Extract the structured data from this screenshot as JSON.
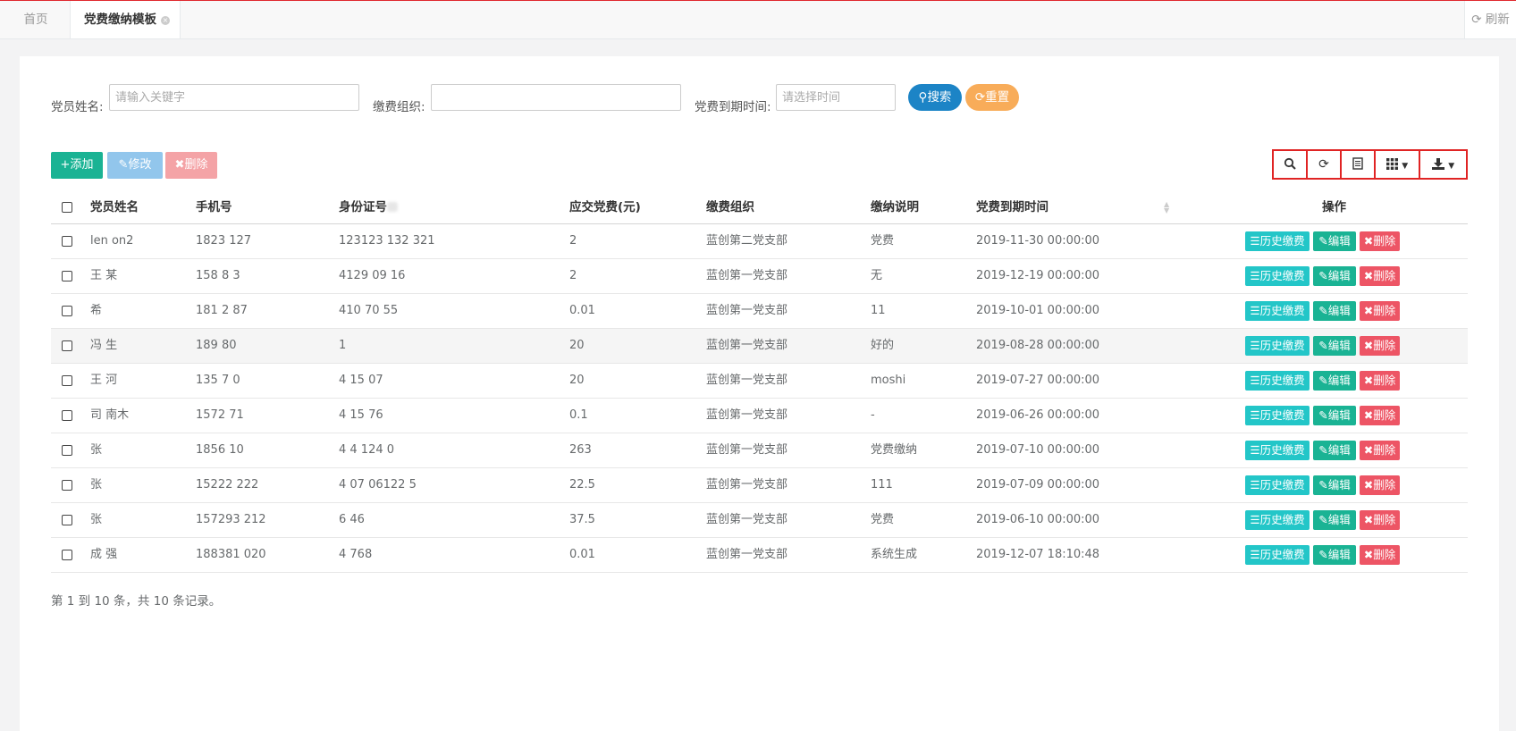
{
  "tabs": {
    "home": "首页",
    "active": "党费缴纳模板",
    "refresh": "刷新"
  },
  "search": {
    "name_label": "党员姓名:",
    "name_placeholder": "请输入关键字",
    "org_label": "缴费组织:",
    "org_value": "",
    "expire_label": "党费到期时间:",
    "expire_placeholder": "请选择时间",
    "search_btn": "搜索",
    "reset_btn": "重置"
  },
  "actions": {
    "add": "添加",
    "edit": "修改",
    "delete": "删除"
  },
  "colors": {
    "accent_red": "#e02424",
    "primary": "#1ab394",
    "info": "#23c6c8",
    "danger": "#ed5565",
    "search_blue": "#1c84c6",
    "reset_orange": "#f8ac59"
  },
  "table": {
    "headers": [
      "党员姓名",
      "手机号",
      "身份证号",
      "应交党费(元)",
      "缴费组织",
      "缴纳说明",
      "党费到期时间",
      "操作"
    ],
    "op_labels": {
      "history": "历史缴费",
      "edit": "编辑",
      "delete": "删除"
    },
    "rows": [
      {
        "name": "len on2",
        "phone": "1823 127",
        "id": "123123 132 321",
        "fee": "2",
        "org": "蓝创第二党支部",
        "note": "党费",
        "expire": "2019-11-30 00:00:00"
      },
      {
        "name": "王 某",
        "phone": "158 8 3",
        "id": "4129 09 16",
        "fee": "2",
        "org": "蓝创第一党支部",
        "note": "无",
        "expire": "2019-12-19 00:00:00"
      },
      {
        "name": "希",
        "phone": "181 2 87",
        "id": "410 70 55",
        "fee": "0.01",
        "org": "蓝创第一党支部",
        "note": "11",
        "expire": "2019-10-01 00:00:00"
      },
      {
        "name": "冯 生",
        "phone": "189 80",
        "id": "1",
        "fee": "20",
        "org": "蓝创第一党支部",
        "note": "好的",
        "expire": "2019-08-28 00:00:00"
      },
      {
        "name": "王 河",
        "phone": "135 7 0",
        "id": "4 15 07",
        "fee": "20",
        "org": "蓝创第一党支部",
        "note": "moshi",
        "expire": "2019-07-27 00:00:00"
      },
      {
        "name": "司 南木",
        "phone": "1572 71",
        "id": "4 15 76",
        "fee": "0.1",
        "org": "蓝创第一党支部",
        "note": "-",
        "expire": "2019-06-26 00:00:00"
      },
      {
        "name": "张",
        "phone": "1856 10",
        "id": "4 4 124 0",
        "fee": "263",
        "org": "蓝创第一党支部",
        "note": "党费缴纳",
        "expire": "2019-07-10 00:00:00"
      },
      {
        "name": "张",
        "phone": "15222 222",
        "id": "4 07 06122 5",
        "fee": "22.5",
        "org": "蓝创第一党支部",
        "note": "111",
        "expire": "2019-07-09 00:00:00"
      },
      {
        "name": "张",
        "phone": "157293 212",
        "id": "6 46",
        "fee": "37.5",
        "org": "蓝创第一党支部",
        "note": "党费",
        "expire": "2019-06-10 00:00:00"
      },
      {
        "name": "成 强",
        "phone": "188381 020",
        "id": "4 768",
        "fee": "0.01",
        "org": "蓝创第一党支部",
        "note": "系统生成",
        "expire": "2019-12-07 18:10:48"
      }
    ]
  },
  "footer": {
    "summary": "第 1 到 10 条，共 10 条记录。"
  }
}
